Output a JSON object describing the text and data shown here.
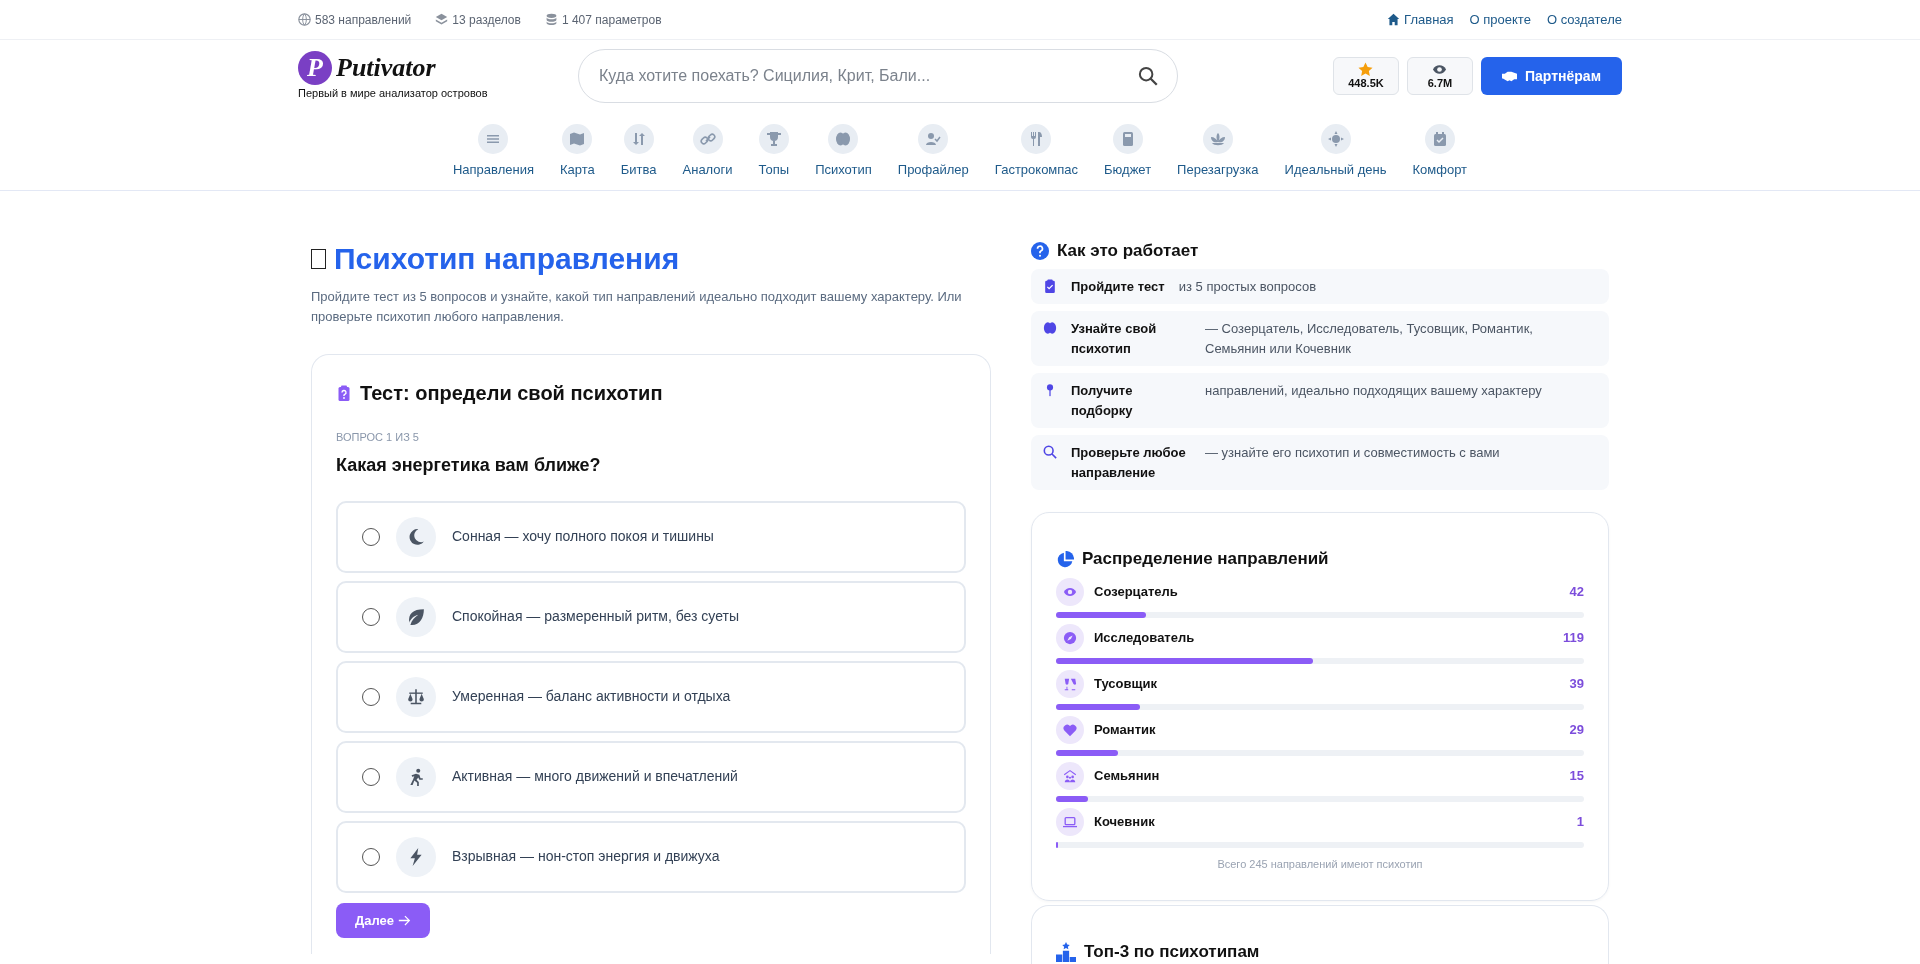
{
  "top_bar": {
    "stats": [
      "583 направлений",
      "13 разделов",
      "1 407 параметров"
    ],
    "links": [
      "Главная",
      "О проекте",
      "О создателе"
    ]
  },
  "header": {
    "logo_mark": "P",
    "logo_text": "Putivator",
    "tagline": "Первый в мире анализатор островов",
    "search": {
      "placeholder": "Куда хотите поехать? Сицилия, Крит, Бали..."
    },
    "counters": [
      "448.5K",
      "6.7M"
    ],
    "partner_button": "Партнёрам"
  },
  "nav": [
    {
      "label": "Направления"
    },
    {
      "label": "Карта"
    },
    {
      "label": "Битва"
    },
    {
      "label": "Аналоги"
    },
    {
      "label": "Топы"
    },
    {
      "label": "Психотип"
    },
    {
      "label": "Профайлер"
    },
    {
      "label": "Гастрокомпас"
    },
    {
      "label": "Бюджет"
    },
    {
      "label": "Перезагрузка"
    },
    {
      "label": "Идеальный день"
    },
    {
      "label": "Комфорт"
    }
  ],
  "page": {
    "title": "Психотип направления",
    "subtitle": "Пройдите тест из 5 вопросов и узнайте, какой тип направлений идеально подходит вашему характеру. Или проверьте психотип любого направления."
  },
  "quiz": {
    "title": "Тест: определи свой психотип",
    "progress": "ВОПРОС 1 ИЗ 5",
    "question": "Какая энергетика вам ближе?",
    "options": [
      {
        "label": "Сонная — хочу полного покоя и тишины",
        "selected": false
      },
      {
        "label": "Спокойная — размеренный ритм, без суеты",
        "selected": false
      },
      {
        "label": "Умеренная — баланс активности и отдыха",
        "selected": false
      },
      {
        "label": "Активная — много движений и впечатлений",
        "selected": false
      },
      {
        "label": "Взрывная — нон-стоп энергия и движуха",
        "selected": false
      }
    ],
    "next_button": "Далее"
  },
  "how_it_works": {
    "title": "Как это работает",
    "steps": [
      {
        "title": "Пройдите тест",
        "text": "из 5 простых вопросов"
      },
      {
        "title": "Узнайте свой психотип",
        "text": "— Созерцатель, Исследователь, Тусовщик, Романтик, Семьянин или Кочевник"
      },
      {
        "title": "Получите подборку",
        "text": "направлений, идеально подходящих вашему характеру"
      },
      {
        "title": "Проверьте любое направление",
        "text": "— узнайте его психотип и совместимость с вами"
      }
    ]
  },
  "distribution": {
    "title": "Распределение направлений",
    "rows": [
      {
        "name": "Созерцатель",
        "count": "42",
        "level": 0.171
      },
      {
        "name": "Исследователь",
        "count": "119",
        "level": 0.486
      },
      {
        "name": "Тусовщик",
        "count": "39",
        "level": 0.159
      },
      {
        "name": "Романтик",
        "count": "29",
        "level": 0.118
      },
      {
        "name": "Семьянин",
        "count": "15",
        "level": 0.061
      },
      {
        "name": "Кочевник",
        "count": "1",
        "level": 0.004
      }
    ],
    "footer": "Всего 245 направлений имеют психотип"
  },
  "top3": {
    "title": "Топ-3 по психотипам"
  }
}
